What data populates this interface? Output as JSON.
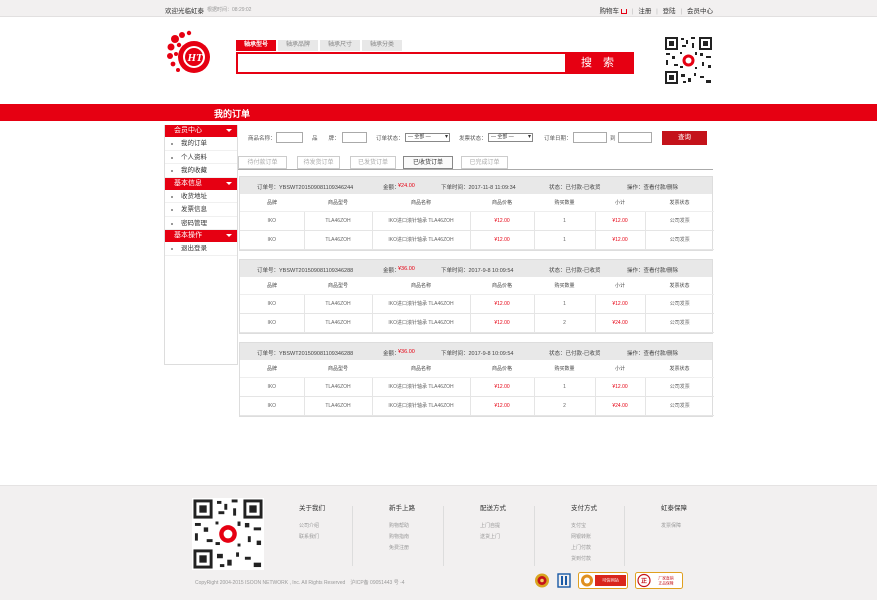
{
  "topbar": {
    "welcome": "欢迎光临虹泰",
    "time": "根据时间：08:29:02",
    "links": [
      "购物车",
      "注册",
      "登陆",
      "会员中心"
    ]
  },
  "search": {
    "tabs": [
      "轴承型号",
      "轴承品牌",
      "轴承尺寸",
      "轴承分类"
    ],
    "value": "",
    "button": "搜 索"
  },
  "page_title": "我的订单",
  "sidebar": [
    {
      "title": "会员中心",
      "items": [
        "我的订单",
        "个人资料",
        "我的收藏"
      ]
    },
    {
      "title": "基本信息",
      "items": [
        "收货地址",
        "发票信息",
        "密码管理"
      ]
    },
    {
      "title": "基本操作",
      "items": [
        "退出登录"
      ]
    }
  ],
  "filters": {
    "name_label": "商品名称：",
    "brand_label": "品　　牌：",
    "order_status_label": "订单状态：",
    "order_status_value": "— 全部 —",
    "invoice_status_label": "发票状态：",
    "invoice_status_value": "— 全部 —",
    "date_label": "订单日期：",
    "date_to": "到",
    "query_button": "查询"
  },
  "status_tabs": [
    "待付款订单",
    "待发货订单",
    "已发货订单",
    "已收货订单",
    "已完成订单"
  ],
  "active_status_tab": 3,
  "columns": [
    "品牌",
    "商品型号",
    "商品名称",
    "商品价格",
    "购买数量",
    "小计",
    "发票状态"
  ],
  "orders": [
    {
      "no": "订单号：YBSWT201509081109346244",
      "amount_label": "金额：",
      "amount": "¥24.00",
      "time": "下单时间：2017-11-8 11:09:34",
      "status": "状态：已付款-已收货",
      "ops": "操作：查看付款/删除",
      "rows": [
        {
          "brand": "IKO",
          "model": "TLA46ZOH",
          "name": "IKO进口滚针轴承 TLA46ZOH",
          "price": "¥12.00",
          "qty": "1",
          "subtotal": "¥12.00",
          "invoice": "公司发票"
        },
        {
          "brand": "IKO",
          "model": "TLA46ZOH",
          "name": "IKO进口滚针轴承 TLA46ZOH",
          "price": "¥12.00",
          "qty": "1",
          "subtotal": "¥12.00",
          "invoice": "公司发票"
        }
      ]
    },
    {
      "no": "订单号：YBSWT201509081109346288",
      "amount_label": "金额：",
      "amount": "¥36.00",
      "time": "下单时间：2017-9-8 10:09:54",
      "status": "状态：已付款-已收货",
      "ops": "操作：查看付款/删除",
      "rows": [
        {
          "brand": "IKO",
          "model": "TLA46ZOH",
          "name": "IKO进口滚针轴承 TLA46ZOH",
          "price": "¥12.00",
          "qty": "1",
          "subtotal": "¥12.00",
          "invoice": "公司发票"
        },
        {
          "brand": "IKO",
          "model": "TLA46ZOH",
          "name": "IKO进口滚针轴承 TLA46ZOH",
          "price": "¥12.00",
          "qty": "2",
          "subtotal": "¥24.00",
          "invoice": "公司发票"
        }
      ]
    },
    {
      "no": "订单号：YBSWT201509081109346288",
      "amount_label": "金额：",
      "amount": "¥36.00",
      "time": "下单时间：2017-9-8 10:09:54",
      "status": "状态：已付款-已收货",
      "ops": "操作：查看付款/删除",
      "rows": [
        {
          "brand": "IKO",
          "model": "TLA46ZOH",
          "name": "IKO进口滚针轴承 TLA46ZOH",
          "price": "¥12.00",
          "qty": "1",
          "subtotal": "¥12.00",
          "invoice": "公司发票"
        },
        {
          "brand": "IKO",
          "model": "TLA46ZOH",
          "name": "IKO进口滚针轴承 TLA46ZOH",
          "price": "¥12.00",
          "qty": "2",
          "subtotal": "¥24.00",
          "invoice": "公司发票"
        }
      ]
    }
  ],
  "footer": {
    "columns": [
      {
        "title": "关于我们",
        "links": [
          "公司介绍",
          "联系我们"
        ]
      },
      {
        "title": "新手上路",
        "links": [
          "购物帮助",
          "购物指南",
          "免费注册"
        ]
      },
      {
        "title": "配送方式",
        "links": [
          "上门自提",
          "送货上门"
        ]
      },
      {
        "title": "支付方式",
        "links": [
          "支付宝",
          "网银转账",
          "上门付款",
          "货到付款"
        ]
      },
      {
        "title": "虹泰保障",
        "links": [
          "发票保障"
        ]
      }
    ],
    "copyright": "CopyRight 2004-2015 ISOON NETWORK , Inc. All Rights Reserved　沪ICP备 09051443 号 -4",
    "badge_trust": "可信网站",
    "badge_genuine": "厂家直销\n正品保障"
  },
  "colors": {
    "brand_red": "#e60012",
    "header_gray": "#f2f0f0"
  }
}
